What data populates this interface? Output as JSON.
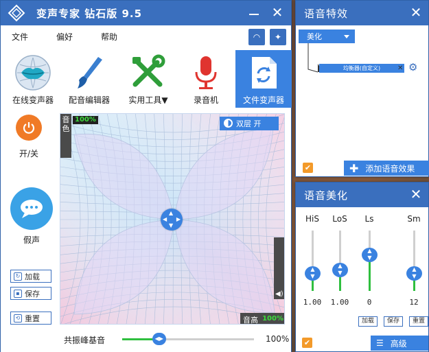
{
  "main": {
    "title": "变声专家 钻石版 9.5",
    "menu": [
      "文件",
      "偏好",
      "帮助"
    ],
    "tools": [
      {
        "label": "在线变声器",
        "icon": "lips-icon"
      },
      {
        "label": "配音编辑器",
        "icon": "brush-icon"
      },
      {
        "label": "实用工具▼",
        "icon": "tools-icon"
      },
      {
        "label": "录音机",
        "icon": "microphone-icon"
      },
      {
        "label": "文件变声器",
        "icon": "file-refresh-icon"
      }
    ],
    "power_label": "开/关",
    "fake_label": "假声",
    "load_label": "加载",
    "save_label": "保存",
    "reset_label": "重置",
    "timbre_label": "音色",
    "timbre_pct": "100%",
    "pitch_label": "音高",
    "pitch_pct": "100%",
    "dual_label": "双层 开",
    "formant_label": "共振峰基音",
    "formant_pct": "100%",
    "formant_value": 0.28
  },
  "effects": {
    "title": "语音特效",
    "dropdown": "美化",
    "equalizer_tag": "均衡器(自定义)",
    "add_label": "添加语音效果"
  },
  "beautify": {
    "title": "语音美化",
    "columns": [
      {
        "label": "HiS",
        "value": "1.00",
        "fill": 0.3
      },
      {
        "label": "LoS",
        "value": "1.00",
        "fill": 0.35
      },
      {
        "label": "Ls",
        "value": "0",
        "fill": 0.6
      },
      {
        "label": "Sm",
        "value": "12",
        "fill": 0.3
      }
    ],
    "load_label": "加载",
    "save_label": "保存",
    "reset_label": "重置",
    "advanced_label": "高级"
  },
  "colors": {
    "accent": "#3a82e0",
    "titlebar": "#3a6fbe",
    "green": "#2fbf3f",
    "orange": "#f39a2a"
  }
}
